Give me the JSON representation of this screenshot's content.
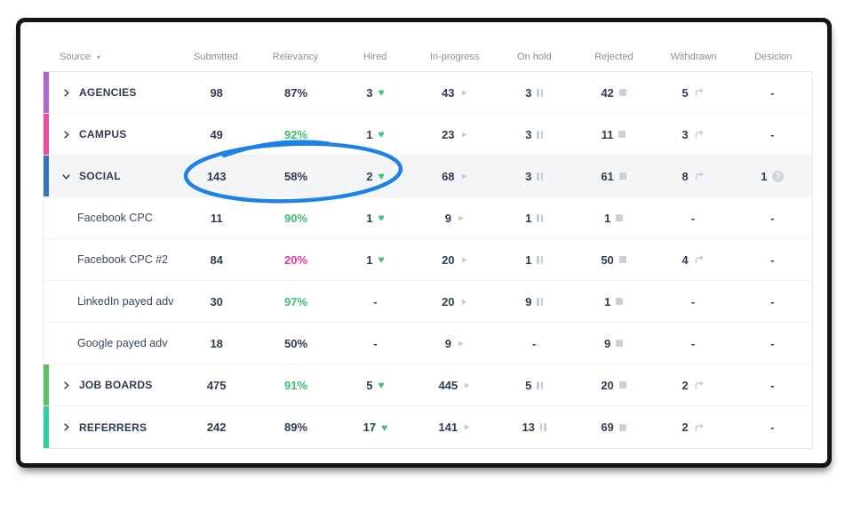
{
  "columns": [
    "Source",
    "Submitted",
    "Relevancy",
    "Hired",
    "In-progress",
    "On hold",
    "Rejected",
    "Withdrawn",
    "Desicion"
  ],
  "sorted_column": "Source",
  "rows": [
    {
      "name": "AGENCIES",
      "type": "group",
      "expanded": false,
      "bar_color": "#b164d4",
      "submitted": "98",
      "relevancy": "87%",
      "relevancy_color": "#2e3d54",
      "hired": "3",
      "in_progress": "43",
      "on_hold": "3",
      "rejected": "42",
      "withdrawn": "5",
      "decision": "-"
    },
    {
      "name": "CAMPUS",
      "type": "group",
      "expanded": false,
      "bar_color": "#e84f9e",
      "submitted": "49",
      "relevancy": "92%",
      "relevancy_color": "#3ebd72",
      "hired": "1",
      "in_progress": "23",
      "on_hold": "3",
      "rejected": "11",
      "withdrawn": "3",
      "decision": "-"
    },
    {
      "name": "SOCIAL",
      "type": "group",
      "expanded": true,
      "highlighted": true,
      "bar_color": "#3d80d4",
      "submitted": "143",
      "relevancy": "58%",
      "relevancy_color": "#2e3d54",
      "hired": "2",
      "in_progress": "68",
      "on_hold": "3",
      "rejected": "61",
      "withdrawn": "8",
      "decision": "1"
    },
    {
      "name": "Facebook CPC",
      "type": "child",
      "submitted": "11",
      "relevancy": "90%",
      "relevancy_color": "#3ebd72",
      "hired": "1",
      "in_progress": "9",
      "on_hold": "1",
      "rejected": "1",
      "withdrawn": "-",
      "decision": "-"
    },
    {
      "name": "Facebook CPC #2",
      "type": "child",
      "submitted": "84",
      "relevancy": "20%",
      "relevancy_color": "#e5399b",
      "hired": "1",
      "in_progress": "20",
      "on_hold": "1",
      "rejected": "50",
      "withdrawn": "4",
      "decision": "-"
    },
    {
      "name": "LinkedIn payed adv",
      "type": "child",
      "submitted": "30",
      "relevancy": "97%",
      "relevancy_color": "#3ebd72",
      "hired": "-",
      "in_progress": "20",
      "on_hold": "9",
      "rejected": "1",
      "withdrawn": "-",
      "decision": "-"
    },
    {
      "name": "Google payed adv",
      "type": "child",
      "submitted": "18",
      "relevancy": "50%",
      "relevancy_color": "#2e3d54",
      "hired": "-",
      "in_progress": "9",
      "on_hold": "-",
      "rejected": "9",
      "withdrawn": "-",
      "decision": "-"
    },
    {
      "name": "JOB BOARDS",
      "type": "group",
      "expanded": false,
      "bar_color": "#5bc163",
      "submitted": "475",
      "relevancy": "91%",
      "relevancy_color": "#3ebd72",
      "hired": "5",
      "in_progress": "445",
      "on_hold": "5",
      "rejected": "20",
      "withdrawn": "2",
      "decision": "-"
    },
    {
      "name": "REFERRERS",
      "type": "group",
      "expanded": false,
      "bar_color": "#2dd0a1",
      "submitted": "242",
      "relevancy": "89%",
      "relevancy_color": "#2e3d54",
      "hired": "17",
      "in_progress": "141",
      "on_hold": "13",
      "rejected": "69",
      "withdrawn": "2",
      "decision": "-"
    }
  ],
  "icons": {
    "hired": "heart-icon",
    "in_progress": "play-icon",
    "on_hold": "pause-icon",
    "rejected": "square-icon",
    "withdrawn": "redo-arrow-icon",
    "decision_pending": "question-circle-icon"
  },
  "colors": {
    "text_navy": "#2e3d54",
    "green": "#3ebd72",
    "magenta": "#e5399b",
    "icon_gray": "#c5ccd3",
    "header_gray": "#87909b",
    "highlight_row_bg": "#f4f5f6",
    "annotation_blue": "#1e81e6"
  },
  "annotation": {
    "shape": "hand-drawn-ellipse",
    "color": "#1e81e6",
    "around": "143 / 58% / 2 hired of SOCIAL row"
  }
}
